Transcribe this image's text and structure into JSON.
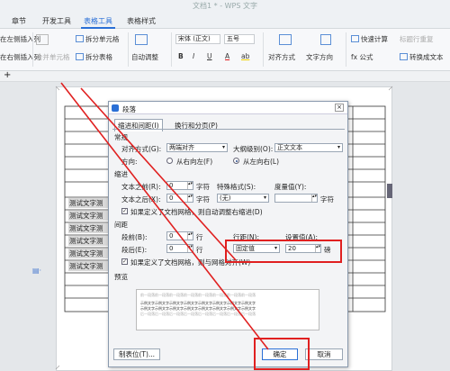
{
  "app": {
    "title": "文档1 * - WPS 文字"
  },
  "tabs": [
    "章节",
    "开发工具",
    "表格工具",
    "表格样式"
  ],
  "ribbon": {
    "insert_col_left": "在左侧插入列",
    "insert_col_right": "在右侧插入列",
    "merge_cells": "合并单元格",
    "split_cells": "拆分单元格",
    "split_table": "拆分表格",
    "auto_fit": "自动调整",
    "font_name": "宋体 (正文)",
    "font_size": "五号",
    "bold": "B",
    "italic": "I",
    "underline": "U",
    "font_color": "A",
    "highlight": "ab",
    "align": "对齐方式",
    "text_dir": "文字方向",
    "quick_calc": "快速计算",
    "title_repeat": "标题行重复",
    "formula": "fx 公式",
    "to_text": "转换成文本"
  },
  "plus": "+",
  "doc": {
    "rows": [
      "测试文字测",
      "测试文字测",
      "测试文字测",
      "测试文字测",
      "测试文字测",
      "测试文字测"
    ]
  },
  "dialog": {
    "title": "段落",
    "tab_indent": "缩进和间距(I)",
    "tab_break": "换行和分页(P)",
    "sec_general": "常规",
    "align_label": "对齐方式(G):",
    "align_value": "两端对齐",
    "outline_label": "大纲级别(O):",
    "outline_value": "正文文本",
    "dir_label": "方向:",
    "dir_rtl": "从右向左(F)",
    "dir_ltr": "从左向右(L)",
    "sec_indent": "缩进",
    "before_text": "文本之前(R):",
    "before_value": "0",
    "after_text": "文本之后(X):",
    "after_value": "0",
    "unit_char": "字符",
    "special_label": "特殊格式(S):",
    "special_value": "(无)",
    "measure_label": "度量值(Y):",
    "measure_unit": "字符",
    "auto_indent": "如果定义了文档网格，则自动调整右缩进(D)",
    "sec_spacing": "间距",
    "before_para": "段前(B):",
    "before_para_value": "0",
    "after_para": "段后(E):",
    "after_para_value": "0",
    "unit_line": "行",
    "line_spacing_label": "行距(N):",
    "line_spacing_value": "固定值",
    "setting_label": "设置值(A):",
    "setting_value": "20",
    "setting_unit": "磅",
    "snap_grid": "如果定义了文档网格，则与网格对齐(W)",
    "sec_preview": "预览",
    "preview_line1": "前一段落前一段落前一段落前一段落前一段落前一段落前一段落前一段落",
    "preview_line2": "示例文字示例文字示例文字示例文字示例文字示例文字示例文字示例文字",
    "preview_line3": "后一段落后一段落后一段落后一段落后一段落后一段落后一段落后一段落",
    "tabs_button": "制表位(T)...",
    "ok": "确定",
    "cancel": "取消"
  },
  "colors": {
    "accent": "#2a6fd6",
    "highlight_box": "#e02020",
    "arrow": "#e02020"
  }
}
